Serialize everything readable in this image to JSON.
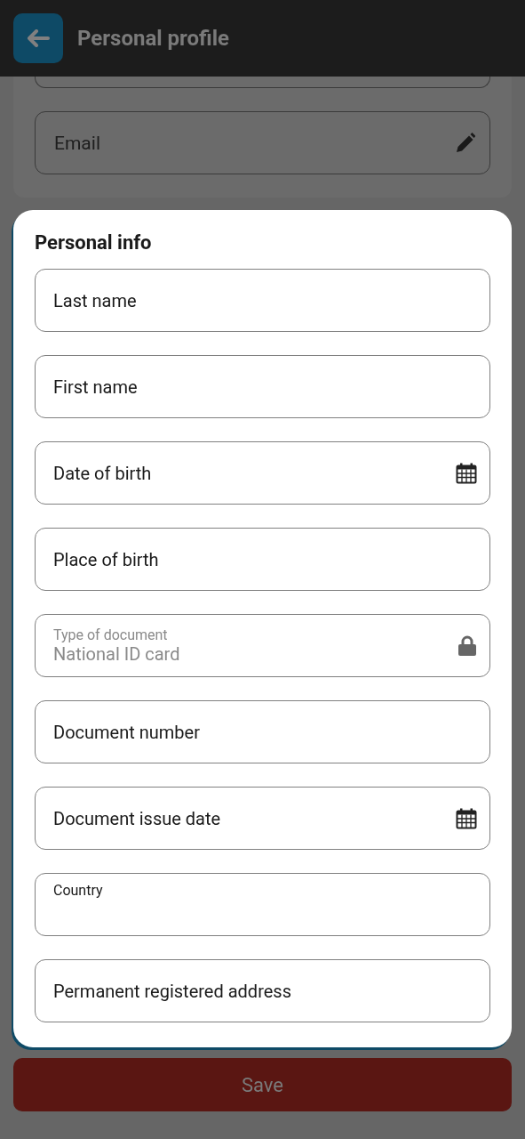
{
  "header": {
    "title": "Personal profile"
  },
  "account_fields": [
    {
      "kind": "cut"
    },
    {
      "kind": "edit",
      "placeholder": "Email"
    }
  ],
  "personal_info": {
    "title": "Personal info",
    "fields": [
      {
        "kind": "text",
        "placeholder": "Last name"
      },
      {
        "kind": "text",
        "placeholder": "First name"
      },
      {
        "kind": "date",
        "placeholder": "Date of birth"
      },
      {
        "kind": "text",
        "placeholder": "Place of birth"
      },
      {
        "kind": "select",
        "label": "Type of document",
        "value": "National ID card",
        "disabled": true
      },
      {
        "kind": "text",
        "placeholder": "Document number"
      },
      {
        "kind": "date",
        "placeholder": "Document issue date"
      },
      {
        "kind": "text",
        "label": "Country"
      },
      {
        "kind": "text",
        "placeholder": "Permanent registered address"
      }
    ]
  },
  "save_button": {
    "label": "Save",
    "disabled": true
  }
}
